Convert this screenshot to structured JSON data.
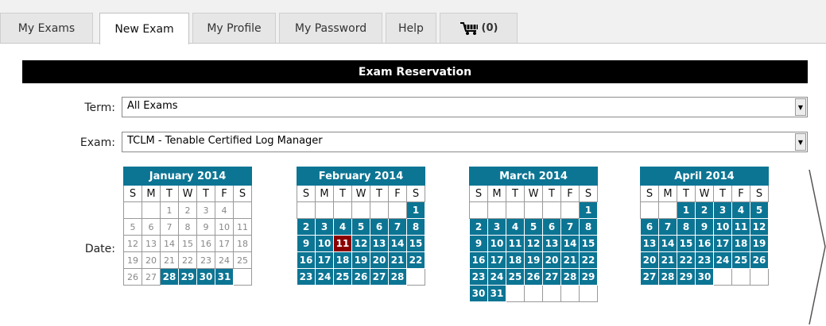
{
  "tabs": [
    {
      "label": "My Exams"
    },
    {
      "label": "New Exam",
      "active": true
    },
    {
      "label": "My Profile"
    },
    {
      "label": "My Password"
    },
    {
      "label": "Help"
    }
  ],
  "cart": {
    "icon": "cart-icon",
    "count": "(0)"
  },
  "title": "Exam Reservation",
  "term": {
    "label": "Term:",
    "value": "All Exams"
  },
  "exam": {
    "label": "Exam:",
    "value": "TCLM - Tenable Certified Log Manager"
  },
  "date": {
    "label": "Date:"
  },
  "colors": {
    "accent": "#0c7594",
    "selected": "#8b0000",
    "header_bg": "#000000"
  },
  "weekdays": [
    "S",
    "M",
    "T",
    "W",
    "T",
    "F",
    "S"
  ],
  "calendars": [
    {
      "month": "January 2014",
      "weeks": [
        [
          null,
          null,
          {
            "d": "1",
            "s": "past"
          },
          {
            "d": "2",
            "s": "past"
          },
          {
            "d": "3",
            "s": "past"
          },
          {
            "d": "4",
            "s": "past"
          }
        ],
        [
          {
            "d": "5",
            "s": "past"
          },
          {
            "d": "6",
            "s": "past"
          },
          {
            "d": "7",
            "s": "past"
          },
          {
            "d": "8",
            "s": "past"
          },
          {
            "d": "9",
            "s": "past"
          },
          {
            "d": "10",
            "s": "past"
          },
          {
            "d": "11",
            "s": "past"
          }
        ],
        [
          {
            "d": "12",
            "s": "past"
          },
          {
            "d": "13",
            "s": "past"
          },
          {
            "d": "14",
            "s": "past"
          },
          {
            "d": "15",
            "s": "past"
          },
          {
            "d": "16",
            "s": "past"
          },
          {
            "d": "17",
            "s": "past"
          },
          {
            "d": "18",
            "s": "past"
          }
        ],
        [
          {
            "d": "19",
            "s": "past"
          },
          {
            "d": "20",
            "s": "past"
          },
          {
            "d": "21",
            "s": "past"
          },
          {
            "d": "22",
            "s": "past"
          },
          {
            "d": "23",
            "s": "past"
          },
          {
            "d": "24",
            "s": "past"
          },
          {
            "d": "25",
            "s": "past"
          }
        ],
        [
          {
            "d": "26",
            "s": "past"
          },
          {
            "d": "27",
            "s": "past"
          },
          {
            "d": "28",
            "s": "avail"
          },
          {
            "d": "29",
            "s": "avail"
          },
          {
            "d": "30",
            "s": "avail"
          },
          {
            "d": "31",
            "s": "avail"
          },
          null
        ]
      ]
    },
    {
      "month": "February 2014",
      "weeks": [
        [
          null,
          null,
          null,
          null,
          null,
          null,
          {
            "d": "1",
            "s": "avail"
          }
        ],
        [
          {
            "d": "2",
            "s": "avail"
          },
          {
            "d": "3",
            "s": "avail"
          },
          {
            "d": "4",
            "s": "avail"
          },
          {
            "d": "5",
            "s": "avail"
          },
          {
            "d": "6",
            "s": "avail"
          },
          {
            "d": "7",
            "s": "avail"
          },
          {
            "d": "8",
            "s": "avail"
          }
        ],
        [
          {
            "d": "9",
            "s": "avail"
          },
          {
            "d": "10",
            "s": "avail"
          },
          {
            "d": "11",
            "s": "sel"
          },
          {
            "d": "12",
            "s": "avail"
          },
          {
            "d": "13",
            "s": "avail"
          },
          {
            "d": "14",
            "s": "avail"
          },
          {
            "d": "15",
            "s": "avail"
          }
        ],
        [
          {
            "d": "16",
            "s": "avail"
          },
          {
            "d": "17",
            "s": "avail"
          },
          {
            "d": "18",
            "s": "avail"
          },
          {
            "d": "19",
            "s": "avail"
          },
          {
            "d": "20",
            "s": "avail"
          },
          {
            "d": "21",
            "s": "avail"
          },
          {
            "d": "22",
            "s": "avail"
          }
        ],
        [
          {
            "d": "23",
            "s": "avail"
          },
          {
            "d": "24",
            "s": "avail"
          },
          {
            "d": "25",
            "s": "avail"
          },
          {
            "d": "26",
            "s": "avail"
          },
          {
            "d": "27",
            "s": "avail"
          },
          {
            "d": "28",
            "s": "avail"
          },
          null
        ]
      ]
    },
    {
      "month": "March 2014",
      "weeks": [
        [
          null,
          null,
          null,
          null,
          null,
          null,
          {
            "d": "1",
            "s": "avail"
          }
        ],
        [
          {
            "d": "2",
            "s": "avail"
          },
          {
            "d": "3",
            "s": "avail"
          },
          {
            "d": "4",
            "s": "avail"
          },
          {
            "d": "5",
            "s": "avail"
          },
          {
            "d": "6",
            "s": "avail"
          },
          {
            "d": "7",
            "s": "avail"
          },
          {
            "d": "8",
            "s": "avail"
          }
        ],
        [
          {
            "d": "9",
            "s": "avail"
          },
          {
            "d": "10",
            "s": "avail"
          },
          {
            "d": "11",
            "s": "avail"
          },
          {
            "d": "12",
            "s": "avail"
          },
          {
            "d": "13",
            "s": "avail"
          },
          {
            "d": "14",
            "s": "avail"
          },
          {
            "d": "15",
            "s": "avail"
          }
        ],
        [
          {
            "d": "16",
            "s": "avail"
          },
          {
            "d": "17",
            "s": "avail"
          },
          {
            "d": "18",
            "s": "avail"
          },
          {
            "d": "19",
            "s": "avail"
          },
          {
            "d": "20",
            "s": "avail"
          },
          {
            "d": "21",
            "s": "avail"
          },
          {
            "d": "22",
            "s": "avail"
          }
        ],
        [
          {
            "d": "23",
            "s": "avail"
          },
          {
            "d": "24",
            "s": "avail"
          },
          {
            "d": "25",
            "s": "avail"
          },
          {
            "d": "26",
            "s": "avail"
          },
          {
            "d": "27",
            "s": "avail"
          },
          {
            "d": "28",
            "s": "avail"
          },
          {
            "d": "29",
            "s": "avail"
          }
        ],
        [
          {
            "d": "30",
            "s": "avail"
          },
          {
            "d": "31",
            "s": "avail"
          },
          null,
          null,
          null,
          null,
          null
        ]
      ]
    },
    {
      "month": "April 2014",
      "weeks": [
        [
          null,
          null,
          {
            "d": "1",
            "s": "avail"
          },
          {
            "d": "2",
            "s": "avail"
          },
          {
            "d": "3",
            "s": "avail"
          },
          {
            "d": "4",
            "s": "avail"
          },
          {
            "d": "5",
            "s": "avail"
          }
        ],
        [
          {
            "d": "6",
            "s": "avail"
          },
          {
            "d": "7",
            "s": "avail"
          },
          {
            "d": "8",
            "s": "avail"
          },
          {
            "d": "9",
            "s": "avail"
          },
          {
            "d": "10",
            "s": "avail"
          },
          {
            "d": "11",
            "s": "avail"
          },
          {
            "d": "12",
            "s": "avail"
          }
        ],
        [
          {
            "d": "13",
            "s": "avail"
          },
          {
            "d": "14",
            "s": "avail"
          },
          {
            "d": "15",
            "s": "avail"
          },
          {
            "d": "16",
            "s": "avail"
          },
          {
            "d": "17",
            "s": "avail"
          },
          {
            "d": "18",
            "s": "avail"
          },
          {
            "d": "19",
            "s": "avail"
          }
        ],
        [
          {
            "d": "20",
            "s": "avail"
          },
          {
            "d": "21",
            "s": "avail"
          },
          {
            "d": "22",
            "s": "avail"
          },
          {
            "d": "23",
            "s": "avail"
          },
          {
            "d": "24",
            "s": "avail"
          },
          {
            "d": "25",
            "s": "avail"
          },
          {
            "d": "26",
            "s": "avail"
          }
        ],
        [
          {
            "d": "27",
            "s": "avail"
          },
          {
            "d": "28",
            "s": "avail"
          },
          {
            "d": "29",
            "s": "avail"
          },
          {
            "d": "30",
            "s": "avail"
          },
          null,
          null,
          null
        ]
      ]
    }
  ],
  "next_icon": "chevron-right-icon"
}
